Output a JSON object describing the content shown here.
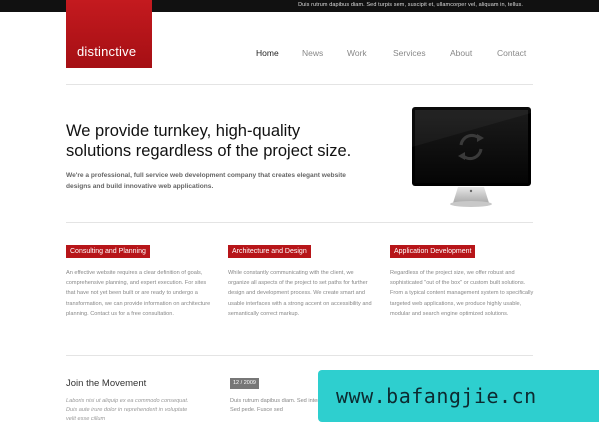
{
  "topbar": {
    "text": "Duis rutrum dapibus diam. Sed turpis sem, suscipit et, ullamcorper vel, aliquam in, tellus."
  },
  "logo": {
    "text": "distinctive"
  },
  "nav": {
    "items": [
      "Home",
      "News",
      "Work",
      "Services",
      "About",
      "Contact"
    ],
    "active": "Home"
  },
  "hero": {
    "headline_line1": "We provide turnkey, high-quality",
    "headline_line2": "solutions regardless of the project size.",
    "intro": "We're a professional, full service web development company that creates elegant website designs and build innovative web applications."
  },
  "icons": {
    "monitor": "monitor-icon",
    "refresh": "refresh-icon"
  },
  "services": [
    {
      "title": "Consulting and Planning",
      "text": "An effective website requires a clear definition of goals, comprehensive planning, and expert execution. For sites that have not yet been built or are ready to undergo a transformation, we can provide information on architecture planning. Contact us for a free consultation."
    },
    {
      "title": "Architecture and Design",
      "text": "While constantly communicating with the client, we organize all aspects of the project to set paths for further design and development process. We create smart and usable interfaces with a strong accent on accessibility and semantically correct markup."
    },
    {
      "title": "Application Development",
      "text": "Regardless of the project size, we offer robust and sophisticated \"out of the box\" or custom built solutions. From a typical content management system to specifically targeted web applications, we produce highly usable, modular and search engine optimized solutions."
    }
  ],
  "join": {
    "title": "Join the Movement",
    "text": "Laboris nisi ut aliquip ex ea commodo consequat. Duis aute irure dolor in reprehenderit in voluptate velit esse cillum"
  },
  "news": {
    "date": "12 / 2009",
    "text": "Duis rutrum dapibus diam. Sed interdum. Sed pede. Fusce sed"
  },
  "watermark": {
    "text": "www.bafangjie.cn"
  },
  "colors": {
    "brand_red": "#b71519",
    "topbar": "#111111",
    "watermark": "#2ecfcf"
  }
}
